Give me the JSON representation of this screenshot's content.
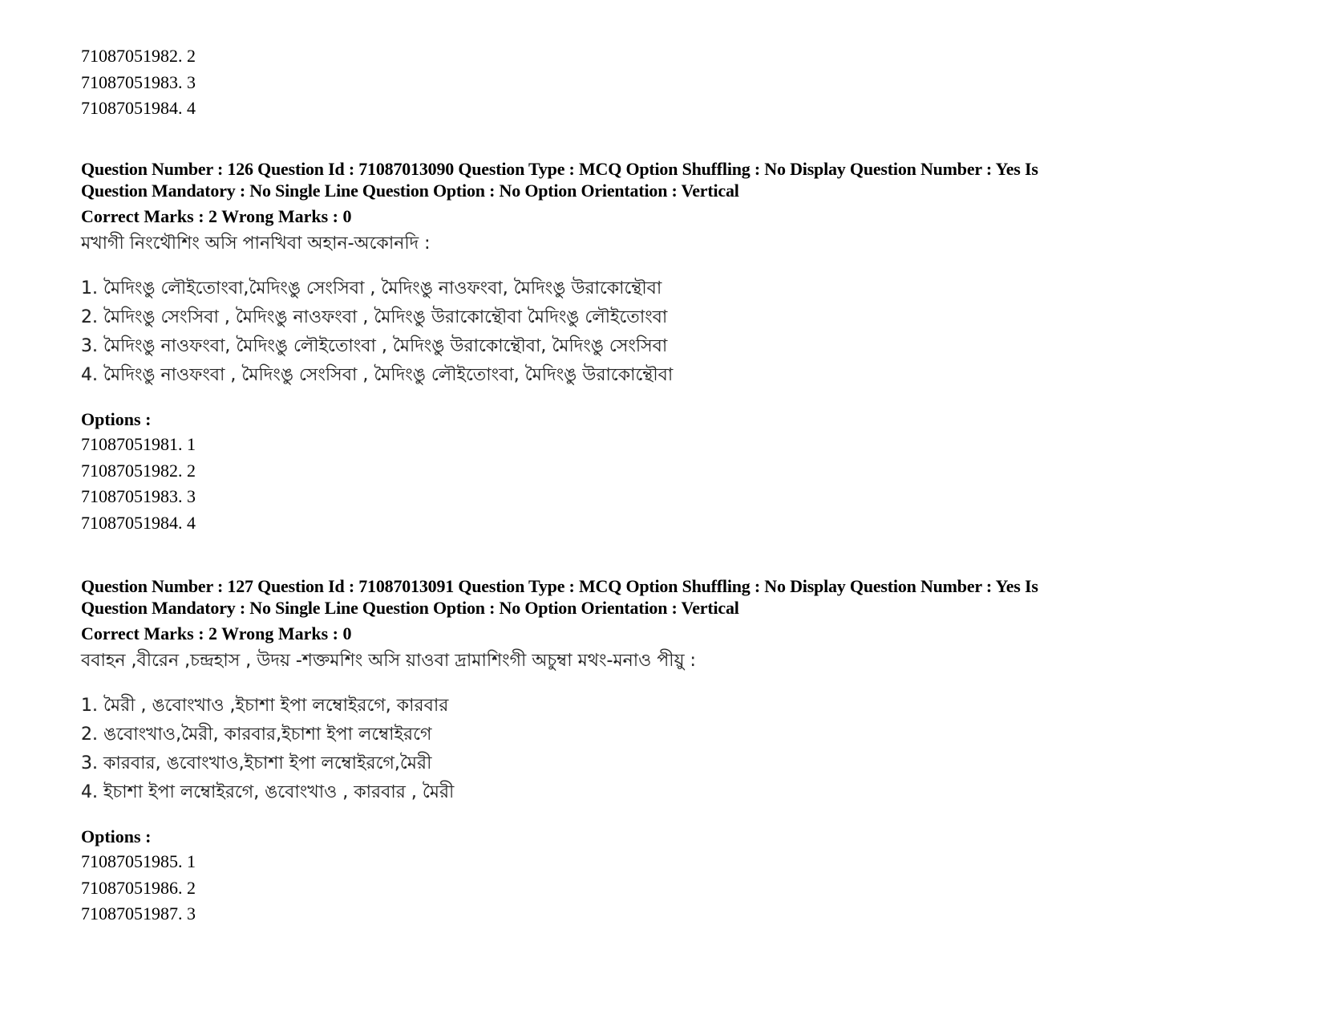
{
  "leading_options": [
    "71087051982. 2",
    "71087051983. 3",
    "71087051984. 4"
  ],
  "questions": [
    {
      "meta_line1": "Question Number : 126 Question Id : 71087013090 Question Type : MCQ Option Shuffling : No Display Question Number : Yes Is",
      "meta_line2": "Question Mandatory : No Single Line Question Option : No Option Orientation : Vertical",
      "marks": "Correct Marks : 2 Wrong Marks : 0",
      "stem": "মখাগী নিংথৌশিং অসি পানখিবা অহান-অকোনদি :",
      "choices": [
        "1. মৈদিংঙু লৌইতোংবা,মৈদিংঙু সেংসিবা , মৈদিংঙু নাওফংবা, মৈদিংঙু উরাকোন্থৌবা",
        "2. মৈদিংঙু সেংসিবা , মৈদিংঙু নাওফংবা , মৈদিংঙু উরাকোন্থৌবা মৈদিংঙু লৌইতোংবা",
        "3. মৈদিংঙু নাওফংবা, মৈদিংঙু লৌইতোংবা , মৈদিংঙু উরাকোন্থৌবা, মৈদিংঙু সেংসিবা",
        "4. মৈদিংঙু নাওফংবা , মৈদিংঙু সেংসিবা , মৈদিংঙু লৌইতোংবা, মৈদিংঙু উরাকোন্থৌবা"
      ],
      "options_label": "Options :",
      "options": [
        "71087051981. 1",
        "71087051982. 2",
        "71087051983. 3",
        "71087051984. 4"
      ]
    },
    {
      "meta_line1": "Question Number : 127 Question Id : 71087013091 Question Type : MCQ Option Shuffling : No Display Question Number : Yes Is",
      "meta_line2": "Question Mandatory : No Single Line Question Option : No Option Orientation : Vertical",
      "marks": "Correct Marks : 2 Wrong Marks : 0",
      "stem": "ববাহন ,বীরেন ,চন্দ্রহাস , উদয় -শক্তমশিং অসি য়াওবা দ্রামাশিংগী অচুম্বা মথং-মনাও পীয়ু :",
      "choices": [
        "1. মৈরী , ঙবোংখাও ,ইচাশা ইপা লম্বোইরগে, কারবার",
        "2. ঙবোংখাও,মৈরী, কারবার,ইচাশা ইপা লম্বোইরগে",
        "3. কারবার, ঙবোংখাও,ইচাশা ইপা লম্বোইরগে,মৈরী",
        "4. ইচাশা ইপা লম্বোইরগে, ঙবোংখাও , কারবার , মৈরী"
      ],
      "options_label": "Options :",
      "options": [
        "71087051985. 1",
        "71087051986. 2",
        "71087051987. 3"
      ]
    }
  ]
}
